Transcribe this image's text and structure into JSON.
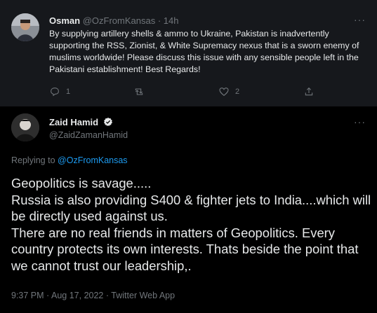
{
  "reply_tweet": {
    "author_name": "Osman",
    "author_handle": "@OzFromKansas",
    "separator": "·",
    "time": "14h",
    "more_label": "···",
    "text": "By supplying artillery shells & ammo to Ukraine, Pakistan is inadvertently supporting the RSS, Zionist, & White Supremacy nexus that is a sworn enemy of muslims worldwide! Please discuss this issue with any sensible people left in the Pakistani establishment! Best Regards!",
    "reply_count": "1",
    "retweet_count": "",
    "like_count": "2"
  },
  "main_tweet": {
    "author_name": "Zaid Hamid",
    "author_handle": "@ZaidZamanHamid",
    "more_label": "···",
    "replying_prefix": "Replying to",
    "replying_to": "@OzFromKansas",
    "text": "Geopolitics is savage.....\nRussia is also providing S400 & fighter jets to India....which will be directly used against us.\nThere are no real friends in matters of Geopolitics. Every country protects its own interests. Thats beside the point that we cannot trust our leadership,.",
    "time": "9:37 PM",
    "separator": "·",
    "date": "Aug 17, 2022",
    "source": "Twitter Web App"
  },
  "colors": {
    "background": "#000000",
    "card_background": "#16181c",
    "text_primary": "#e7e9ea",
    "text_secondary": "#71767b",
    "accent": "#1d9bf0"
  },
  "icons": {
    "reply": "reply-icon",
    "retweet": "retweet-icon",
    "like": "heart-icon",
    "share": "share-icon",
    "verified": "verified-badge-icon"
  }
}
